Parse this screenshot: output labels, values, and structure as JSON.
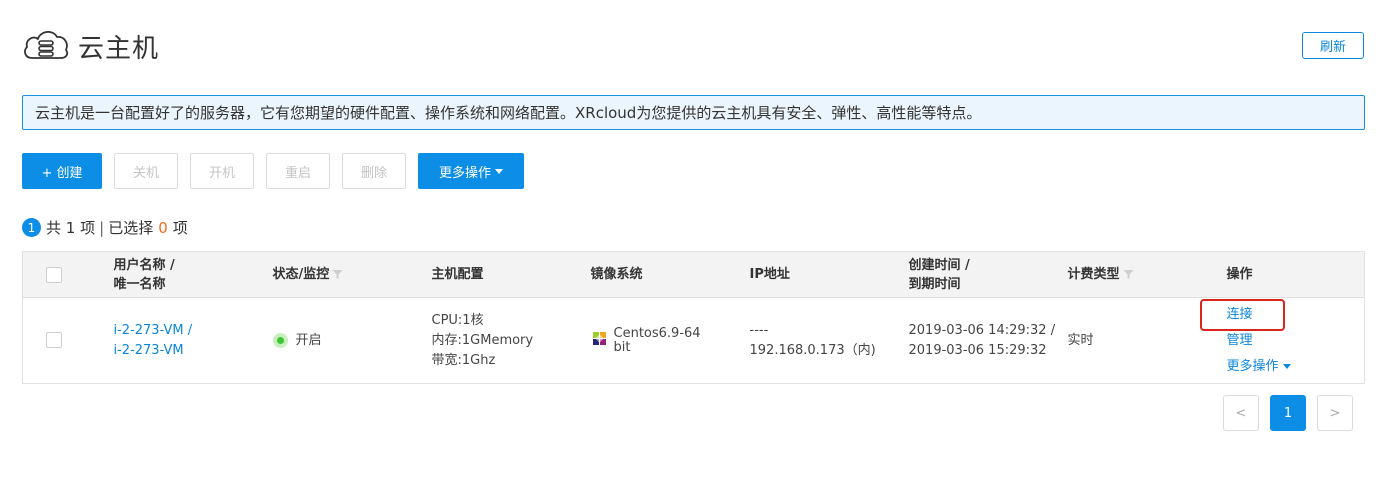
{
  "header": {
    "title": "云主机",
    "refresh_label": "刷新"
  },
  "info": {
    "text": "云主机是一台配置好了的服务器，它有您期望的硬件配置、操作系统和网络配置。XRcloud为您提供的云主机具有安全、弹性、高性能等特点。"
  },
  "toolbar": {
    "create_label": "+ 创建",
    "shutdown_label": "关机",
    "power_on_label": "开机",
    "restart_label": "重启",
    "delete_label": "删除",
    "more_label": "更多操作"
  },
  "summary": {
    "badge": "1",
    "total_prefix": "共",
    "total_count": "1",
    "total_suffix": "项",
    "divider": "|",
    "selected_prefix": "已选择",
    "selected_count": "0",
    "selected_suffix": "项"
  },
  "table": {
    "headers": {
      "name_line1": "用户名称 /",
      "name_line2": "唯一名称",
      "status": "状态/监控",
      "config": "主机配置",
      "image": "镜像系统",
      "ip": "IP地址",
      "time_line1": "创建时间 /",
      "time_line2": "到期时间",
      "billing": "计费类型",
      "actions": "操作"
    },
    "rows": [
      {
        "user_name": "i-2-273-VM /",
        "unique_name": "i-2-273-VM",
        "status": "开启",
        "cpu": "CPU:1核",
        "memory": "内存:1GMemory",
        "bandwidth": "带宽:1Ghz",
        "os_line1": "Centos6.9-64",
        "os_line2": "bit",
        "ip_public": "----",
        "ip_private": "192.168.0.173（内)",
        "created": "2019-03-06 14:29:32 /",
        "expires": "2019-03-06 15:29:32",
        "billing": "实时",
        "action_connect": "连接",
        "action_manage": "管理",
        "action_more": "更多操作"
      }
    ]
  },
  "pagination": {
    "prev": "<",
    "current": "1",
    "next": ">"
  },
  "colors": {
    "accent": "#0c8ee6",
    "highlight": "#d9261c",
    "selected_count": "#f56b1f",
    "status_on": "#3ec533"
  }
}
